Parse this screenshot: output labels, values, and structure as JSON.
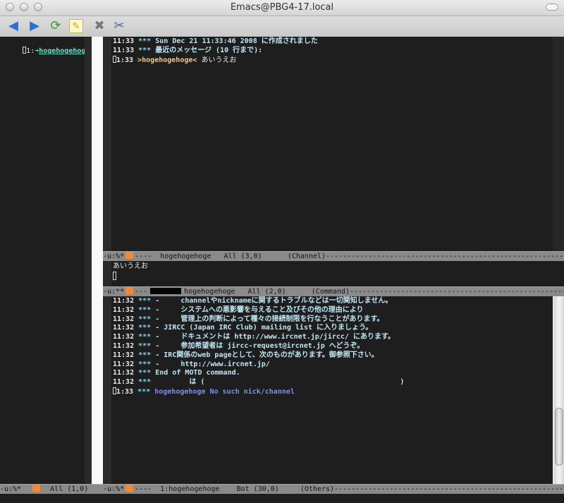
{
  "window": {
    "title": "Emacs@PBG4-17.local"
  },
  "toolbar": {
    "buttons": [
      {
        "name": "back-arrow-icon",
        "glyph": "◀"
      },
      {
        "name": "forward-arrow-icon",
        "glyph": "▶"
      },
      {
        "name": "refresh-icon",
        "glyph": "⟳"
      },
      {
        "name": "new-file-icon",
        "glyph": "✎"
      },
      {
        "name": "close-x-icon",
        "glyph": "✖"
      },
      {
        "name": "tools-icon",
        "glyph": "✂"
      }
    ]
  },
  "left_pane": {
    "index": "1:",
    "arrow": "➜",
    "channel": "hogehogehoge",
    "trunc": ">"
  },
  "channel_pane": {
    "lines": [
      {
        "time": "11:33",
        "stars": "***",
        "text": "Sun Dec 21 11:33:46 2008 に作成されました",
        "kind": "msg"
      },
      {
        "time": "11:33",
        "stars": "***",
        "text": "最近のメッセージ (10 行まで):",
        "kind": "msg"
      },
      {
        "time": "1:33",
        "stars": "",
        "nick": ">hogehogehoge<",
        "text": " あいうえお",
        "kind": "nick",
        "cursor": true
      }
    ],
    "modeline": {
      "left": "-u:%*",
      "after": "----  hogehogehoge   All (3,0)      (Channel)",
      "fill": "---------------------------------------------------------------------"
    }
  },
  "input_pane": {
    "text": "あいうえお"
  },
  "command_modeline": {
    "left": "-u:**",
    "before": "---",
    "after": "hogehogehoge   All (2,0)      (Command)",
    "fill": "---------------------------------------------------------------------"
  },
  "command_pane": {
    "lines": [
      {
        "time": "11:32",
        "stars": "***",
        "text": "-     channelやnicknameに関するトラブルなどは一切関知しません。",
        "kind": "msg"
      },
      {
        "time": "11:32",
        "stars": "***",
        "text": "-     システムへの悪影響を与えること及びその他の理由により",
        "kind": "msg"
      },
      {
        "time": "11:32",
        "stars": "***",
        "text": "-     管理上の判断によって種々の接続制限を行なうことがあります。",
        "kind": "msg"
      },
      {
        "time": "11:32",
        "stars": "***",
        "text": "- JIRCC (Japan IRC Club) mailing list に入りましょう。",
        "kind": "msg"
      },
      {
        "time": "11:32",
        "stars": "***",
        "text": "-     ドキュメントは http://www.ircnet.jp/jircc/ にあります。",
        "kind": "msg"
      },
      {
        "time": "11:32",
        "stars": "***",
        "text": "-     参加希望者は jircc-request@ircnet.jp へどうぞ。",
        "kind": "msg"
      },
      {
        "time": "11:32",
        "stars": "***",
        "text": "- IRC関係のweb pageとして、次のものがあります。御参照下さい。",
        "kind": "msg"
      },
      {
        "time": "11:32",
        "stars": "***",
        "text": "-     http://www.ircnet.jp/",
        "kind": "msg"
      },
      {
        "time": "11:32",
        "stars": "***",
        "text": "End of MOTD command.",
        "kind": "msg"
      },
      {
        "time": "11:32",
        "stars": "***",
        "text": "        は (                                              )",
        "kind": "msg"
      },
      {
        "time": "1:33",
        "stars": "***",
        "text": "hogehogehoge No such nick/channel",
        "kind": "err",
        "cursor": true
      }
    ]
  },
  "bottom_left_modeline": {
    "left": "-u:%*",
    "after": "  All (1,0)"
  },
  "bottom_right_modeline": {
    "left": "-u:%*",
    "after": "----  1:hogehogehoge    Bot (30,0)     (Others)",
    "fill": "-------------------------------------------------------------------------"
  },
  "colors": {
    "background": "#1e1e1e",
    "modeline": "#8a8a8a",
    "accent": "#f08a3a",
    "channel": "#6fe0c8"
  }
}
